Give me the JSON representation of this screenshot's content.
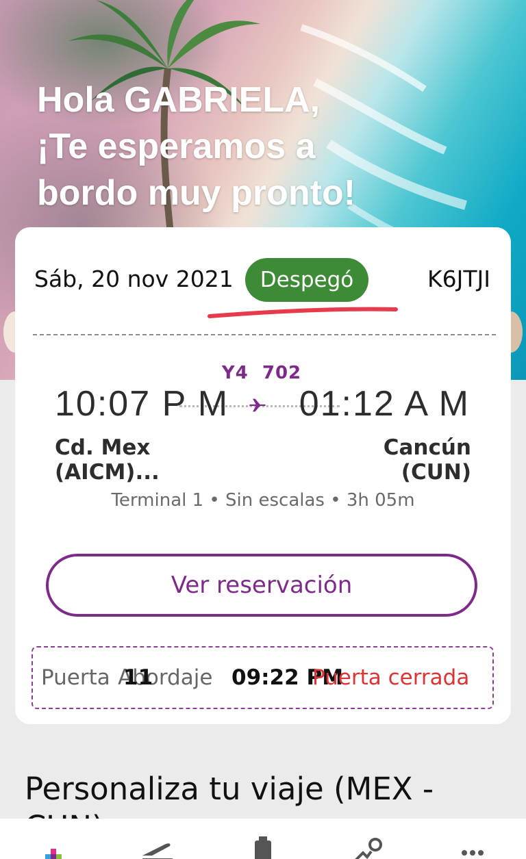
{
  "greeting": {
    "line1": "Hola GABRIELA,",
    "line2": "¡Te esperamos a",
    "line3": "bordo muy pronto!"
  },
  "trip": {
    "date": "Sáb, 20 nov 2021",
    "status": "Despegó",
    "status_color": "#3d8b36",
    "pnr": "K6JTJI",
    "flight_number": "Y4  702",
    "departure_time": "10:07 P M",
    "arrival_time": "01:12 A M",
    "origin_city": "Cd. Mex",
    "origin_code": "(AICM)...",
    "destination_city": "Cancún",
    "destination_code": "(CUN)",
    "details": "Terminal 1 • Sin escalas • 3h 05m"
  },
  "actions": {
    "view_reservation": "Ver reservación"
  },
  "gate": {
    "gate_label": "Puerta",
    "gate_value": "11",
    "boarding_label": "Abordaje",
    "boarding_time": "09:22 PM",
    "gate_status": "Puerta cerrada"
  },
  "section": {
    "title_line1": "Personaliza tu viaje (MEX -",
    "title_line2": "CUN)"
  },
  "tabs": [
    "home-icon",
    "flight-icon",
    "bag-icon",
    "check-in-icon",
    "more-icon"
  ],
  "colors": {
    "brand_purple": "#7d2a8a",
    "alert_red": "#d33",
    "underline_red": "#e83a4a"
  }
}
